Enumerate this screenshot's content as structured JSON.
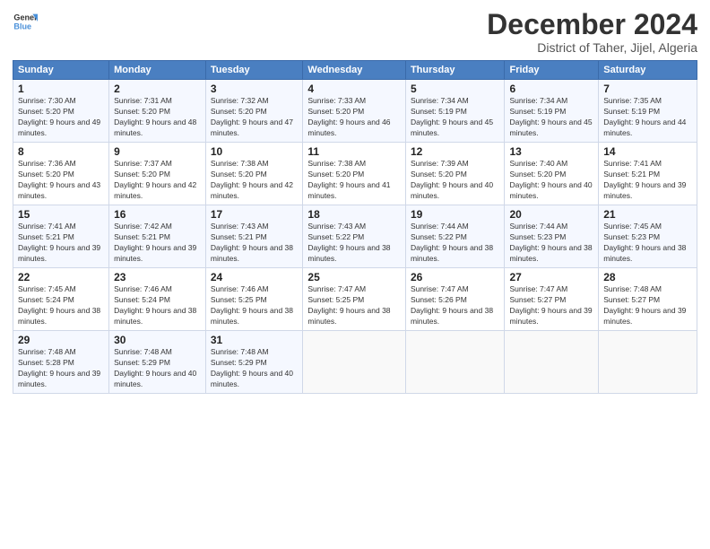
{
  "logo": {
    "line1": "General",
    "line2": "Blue"
  },
  "title": "December 2024",
  "subtitle": "District of Taher, Jijel, Algeria",
  "days_header": [
    "Sunday",
    "Monday",
    "Tuesday",
    "Wednesday",
    "Thursday",
    "Friday",
    "Saturday"
  ],
  "weeks": [
    [
      {
        "day": "1",
        "sunrise": "7:30 AM",
        "sunset": "5:20 PM",
        "daylight": "9 hours and 49 minutes."
      },
      {
        "day": "2",
        "sunrise": "7:31 AM",
        "sunset": "5:20 PM",
        "daylight": "9 hours and 48 minutes."
      },
      {
        "day": "3",
        "sunrise": "7:32 AM",
        "sunset": "5:20 PM",
        "daylight": "9 hours and 47 minutes."
      },
      {
        "day": "4",
        "sunrise": "7:33 AM",
        "sunset": "5:20 PM",
        "daylight": "9 hours and 46 minutes."
      },
      {
        "day": "5",
        "sunrise": "7:34 AM",
        "sunset": "5:19 PM",
        "daylight": "9 hours and 45 minutes."
      },
      {
        "day": "6",
        "sunrise": "7:34 AM",
        "sunset": "5:19 PM",
        "daylight": "9 hours and 45 minutes."
      },
      {
        "day": "7",
        "sunrise": "7:35 AM",
        "sunset": "5:19 PM",
        "daylight": "9 hours and 44 minutes."
      }
    ],
    [
      {
        "day": "8",
        "sunrise": "7:36 AM",
        "sunset": "5:20 PM",
        "daylight": "9 hours and 43 minutes."
      },
      {
        "day": "9",
        "sunrise": "7:37 AM",
        "sunset": "5:20 PM",
        "daylight": "9 hours and 42 minutes."
      },
      {
        "day": "10",
        "sunrise": "7:38 AM",
        "sunset": "5:20 PM",
        "daylight": "9 hours and 42 minutes."
      },
      {
        "day": "11",
        "sunrise": "7:38 AM",
        "sunset": "5:20 PM",
        "daylight": "9 hours and 41 minutes."
      },
      {
        "day": "12",
        "sunrise": "7:39 AM",
        "sunset": "5:20 PM",
        "daylight": "9 hours and 40 minutes."
      },
      {
        "day": "13",
        "sunrise": "7:40 AM",
        "sunset": "5:20 PM",
        "daylight": "9 hours and 40 minutes."
      },
      {
        "day": "14",
        "sunrise": "7:41 AM",
        "sunset": "5:21 PM",
        "daylight": "9 hours and 39 minutes."
      }
    ],
    [
      {
        "day": "15",
        "sunrise": "7:41 AM",
        "sunset": "5:21 PM",
        "daylight": "9 hours and 39 minutes."
      },
      {
        "day": "16",
        "sunrise": "7:42 AM",
        "sunset": "5:21 PM",
        "daylight": "9 hours and 39 minutes."
      },
      {
        "day": "17",
        "sunrise": "7:43 AM",
        "sunset": "5:21 PM",
        "daylight": "9 hours and 38 minutes."
      },
      {
        "day": "18",
        "sunrise": "7:43 AM",
        "sunset": "5:22 PM",
        "daylight": "9 hours and 38 minutes."
      },
      {
        "day": "19",
        "sunrise": "7:44 AM",
        "sunset": "5:22 PM",
        "daylight": "9 hours and 38 minutes."
      },
      {
        "day": "20",
        "sunrise": "7:44 AM",
        "sunset": "5:23 PM",
        "daylight": "9 hours and 38 minutes."
      },
      {
        "day": "21",
        "sunrise": "7:45 AM",
        "sunset": "5:23 PM",
        "daylight": "9 hours and 38 minutes."
      }
    ],
    [
      {
        "day": "22",
        "sunrise": "7:45 AM",
        "sunset": "5:24 PM",
        "daylight": "9 hours and 38 minutes."
      },
      {
        "day": "23",
        "sunrise": "7:46 AM",
        "sunset": "5:24 PM",
        "daylight": "9 hours and 38 minutes."
      },
      {
        "day": "24",
        "sunrise": "7:46 AM",
        "sunset": "5:25 PM",
        "daylight": "9 hours and 38 minutes."
      },
      {
        "day": "25",
        "sunrise": "7:47 AM",
        "sunset": "5:25 PM",
        "daylight": "9 hours and 38 minutes."
      },
      {
        "day": "26",
        "sunrise": "7:47 AM",
        "sunset": "5:26 PM",
        "daylight": "9 hours and 38 minutes."
      },
      {
        "day": "27",
        "sunrise": "7:47 AM",
        "sunset": "5:27 PM",
        "daylight": "9 hours and 39 minutes."
      },
      {
        "day": "28",
        "sunrise": "7:48 AM",
        "sunset": "5:27 PM",
        "daylight": "9 hours and 39 minutes."
      }
    ],
    [
      {
        "day": "29",
        "sunrise": "7:48 AM",
        "sunset": "5:28 PM",
        "daylight": "9 hours and 39 minutes."
      },
      {
        "day": "30",
        "sunrise": "7:48 AM",
        "sunset": "5:29 PM",
        "daylight": "9 hours and 40 minutes."
      },
      {
        "day": "31",
        "sunrise": "7:48 AM",
        "sunset": "5:29 PM",
        "daylight": "9 hours and 40 minutes."
      },
      null,
      null,
      null,
      null
    ]
  ],
  "labels": {
    "sunrise": "Sunrise:",
    "sunset": "Sunset:",
    "daylight": "Daylight:"
  }
}
